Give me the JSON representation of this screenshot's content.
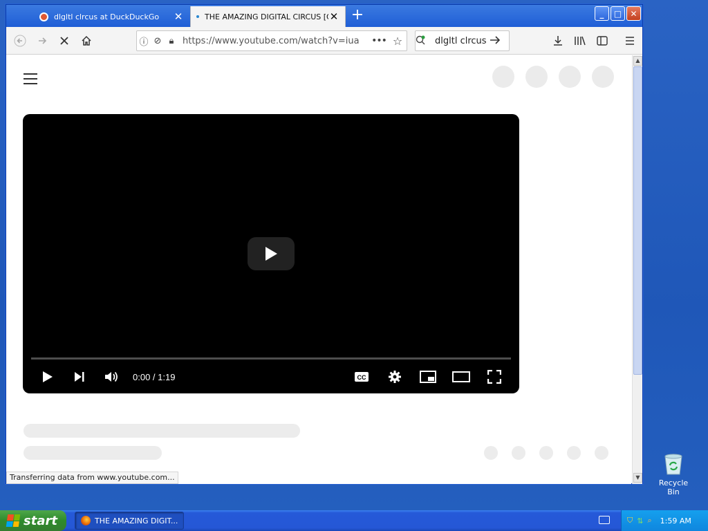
{
  "browser": {
    "tabs": [
      {
        "title": "dlgltl clrcus at DuckDuckGo",
        "active": false
      },
      {
        "title": "THE AMAZING DIGITAL CIRCUS [O",
        "active": true
      }
    ],
    "url": "https://www.youtube.com/watch?v=iua",
    "search_query": "dlgltl clrcus",
    "status_text": "Transferring data from www.youtube.com..."
  },
  "player": {
    "time": "0:00 / 1:19",
    "progress": 0
  },
  "desktop": {
    "recycle_bin_label": "Recycle Bin"
  },
  "taskbar": {
    "start_label": "start",
    "task_label": "THE AMAZING DIGIT...",
    "clock": "1:59 AM"
  },
  "colors": {
    "accent": "#1f5ed6",
    "player_bg": "#000000",
    "start_green": "#2e8b2c"
  }
}
